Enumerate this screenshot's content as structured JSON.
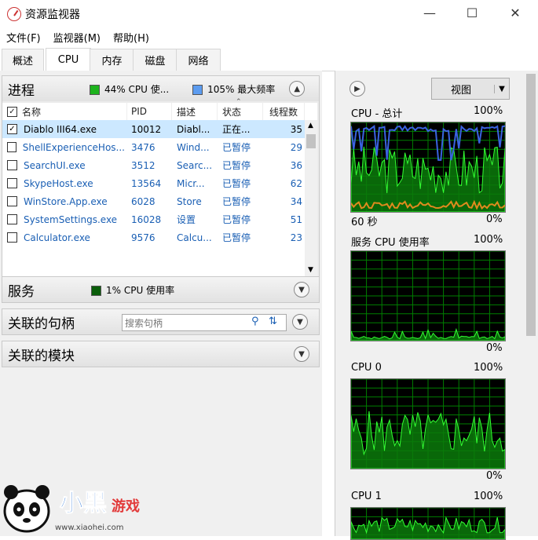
{
  "window": {
    "title": "资源监视器",
    "min": "—",
    "max": "☐",
    "close": "✕"
  },
  "menu": [
    "文件(F)",
    "监视器(M)",
    "帮助(H)"
  ],
  "tabs": [
    "概述",
    "CPU",
    "内存",
    "磁盘",
    "网络"
  ],
  "process_section": {
    "title": "进程",
    "cpu_usage": "44% CPU 使...",
    "max_freq": "105% 最大频率",
    "columns": [
      "名称",
      "PID",
      "描述",
      "状态",
      "线程数"
    ],
    "rows": [
      {
        "name": "Diablo III64.exe",
        "pid": "10012",
        "desc": "Diabl...",
        "status": "正在...",
        "threads": "35",
        "checked": true
      },
      {
        "name": "ShellExperienceHos...",
        "pid": "3476",
        "desc": "Wind...",
        "status": "已暂停",
        "threads": "29",
        "checked": false
      },
      {
        "name": "SearchUI.exe",
        "pid": "3512",
        "desc": "Searc...",
        "status": "已暂停",
        "threads": "36",
        "checked": false
      },
      {
        "name": "SkypeHost.exe",
        "pid": "13564",
        "desc": "Micr...",
        "status": "已暂停",
        "threads": "62",
        "checked": false
      },
      {
        "name": "WinStore.App.exe",
        "pid": "6028",
        "desc": "Store",
        "status": "已暂停",
        "threads": "34",
        "checked": false
      },
      {
        "name": "SystemSettings.exe",
        "pid": "16028",
        "desc": "设置",
        "status": "已暂停",
        "threads": "51",
        "checked": false
      },
      {
        "name": "Calculator.exe",
        "pid": "9576",
        "desc": "Calcu...",
        "status": "已暂停",
        "threads": "23",
        "checked": false
      }
    ]
  },
  "services_section": {
    "title": "服务",
    "usage": "1% CPU 使用率"
  },
  "handles_section": {
    "title": "关联的句柄",
    "search_placeholder": "搜索句柄"
  },
  "modules_section": {
    "title": "关联的模块"
  },
  "right": {
    "view_label": "视图",
    "graphs": [
      {
        "title": "CPU - 总计",
        "max": "100%",
        "time": "60 秒",
        "min": "0%"
      },
      {
        "title": "服务 CPU 使用率",
        "max": "100%",
        "min": "0%"
      },
      {
        "title": "CPU 0",
        "max": "100%",
        "min": "0%"
      },
      {
        "title": "CPU 1",
        "max": "100%"
      }
    ]
  },
  "watermark": {
    "brand": "小黑游戏",
    "url": "www.xiaohei.com"
  },
  "colors": {
    "graph_bg": "#000000",
    "grid": "#007f00",
    "cpu_line": "#1fd61f",
    "freq_line": "#3a63e0",
    "service_line": "#e08a1e",
    "selected_row": "#cce8ff"
  }
}
